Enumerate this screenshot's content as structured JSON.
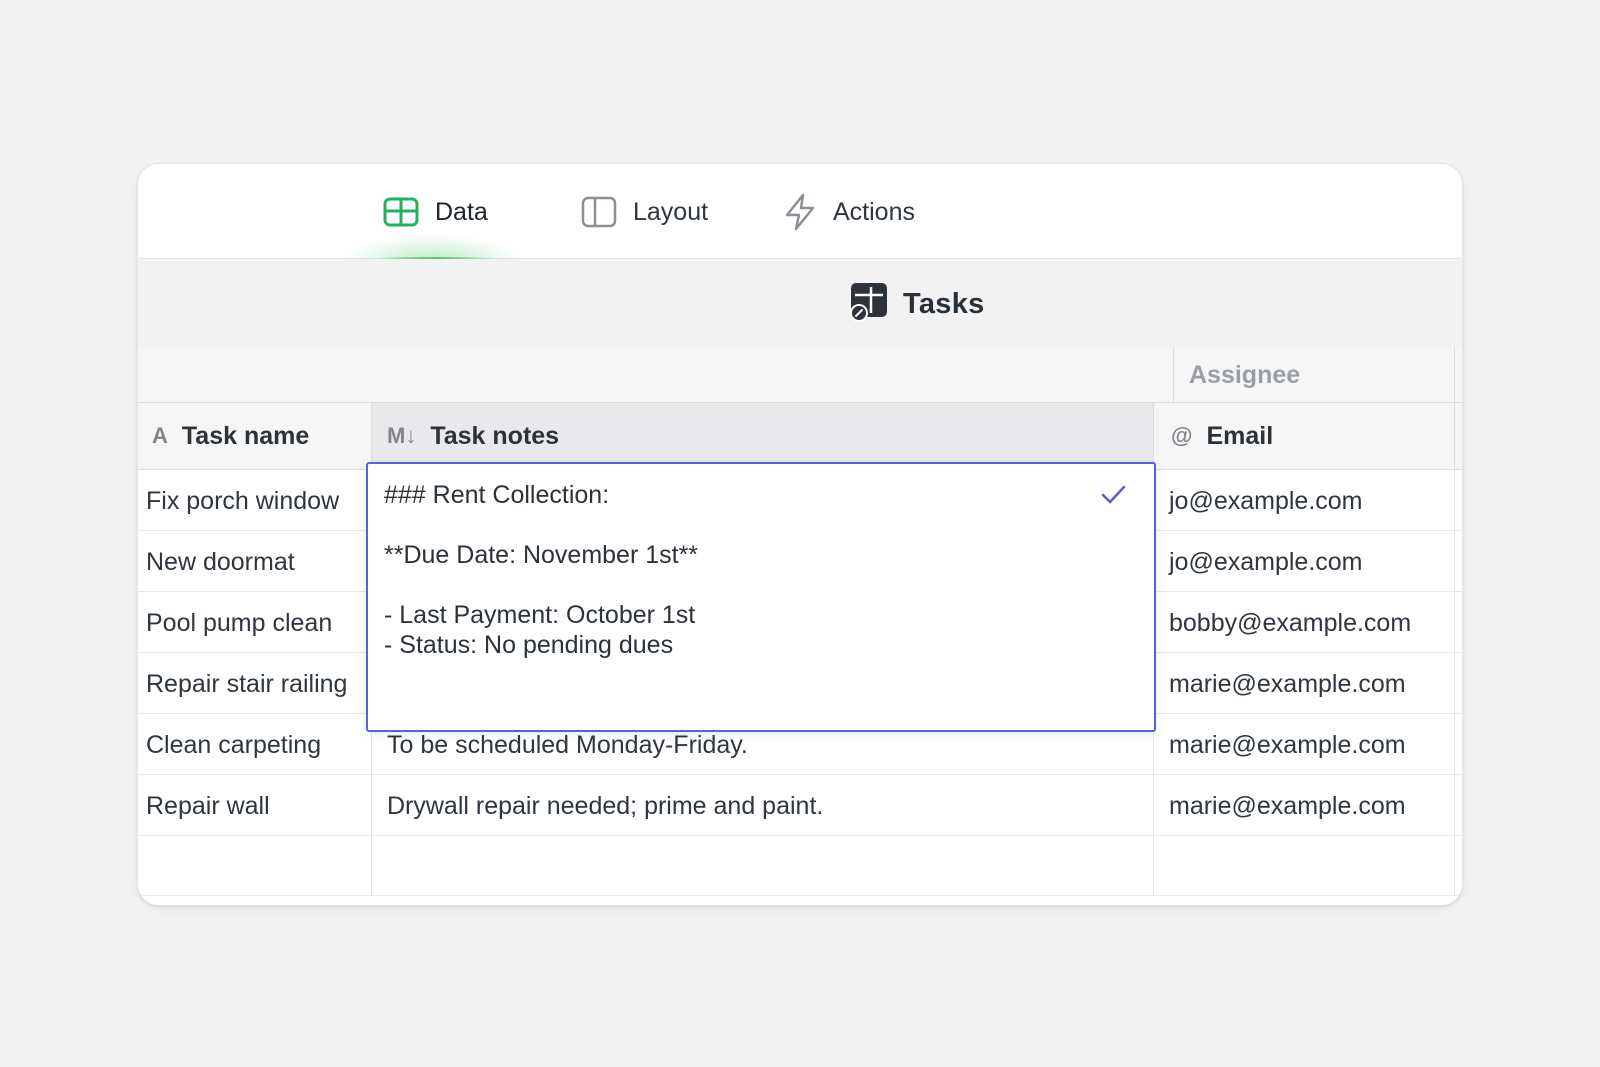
{
  "tabs": [
    {
      "label": "Data",
      "icon": "table-icon",
      "active": true
    },
    {
      "label": "Layout",
      "icon": "layout-icon",
      "active": false
    },
    {
      "label": "Actions",
      "icon": "lightning-icon",
      "active": false
    }
  ],
  "table": {
    "title": "Tasks",
    "icon": "table-app-icon",
    "group_header": "Assignee",
    "columns": [
      {
        "label": "Task name",
        "icon": "text-type-icon",
        "icon_glyph": "A"
      },
      {
        "label": "Task notes",
        "icon": "markdown-icon",
        "icon_glyph": "M↓"
      },
      {
        "label": "Email",
        "icon": "email-type-icon",
        "icon_glyph": "@"
      }
    ],
    "rows": [
      {
        "task_name": "Fix porch window",
        "task_notes": "",
        "email": "jo@example.com"
      },
      {
        "task_name": "New doormat",
        "task_notes": "",
        "email": "jo@example.com"
      },
      {
        "task_name": "Pool pump clean",
        "task_notes": "",
        "email": "bobby@example.com"
      },
      {
        "task_name": "Repair stair railing",
        "task_notes": "",
        "email": "marie@example.com"
      },
      {
        "task_name": "Clean carpeting",
        "task_notes": "To be scheduled Monday-Friday.",
        "email": "marie@example.com"
      },
      {
        "task_name": "Repair wall",
        "task_notes": "Drywall repair needed; prime and paint.",
        "email": "marie@example.com"
      }
    ]
  },
  "editor": {
    "lines": [
      "### Rent Collection:",
      "",
      "**Due Date: November 1st**",
      "",
      "- Last Payment: October 1st",
      "- Status: No pending dues"
    ],
    "confirm_icon": "checkmark-icon"
  },
  "colors": {
    "accent_green": "#22b35e",
    "editor_border": "#5b5fd8",
    "background": "#f2f2f2"
  }
}
